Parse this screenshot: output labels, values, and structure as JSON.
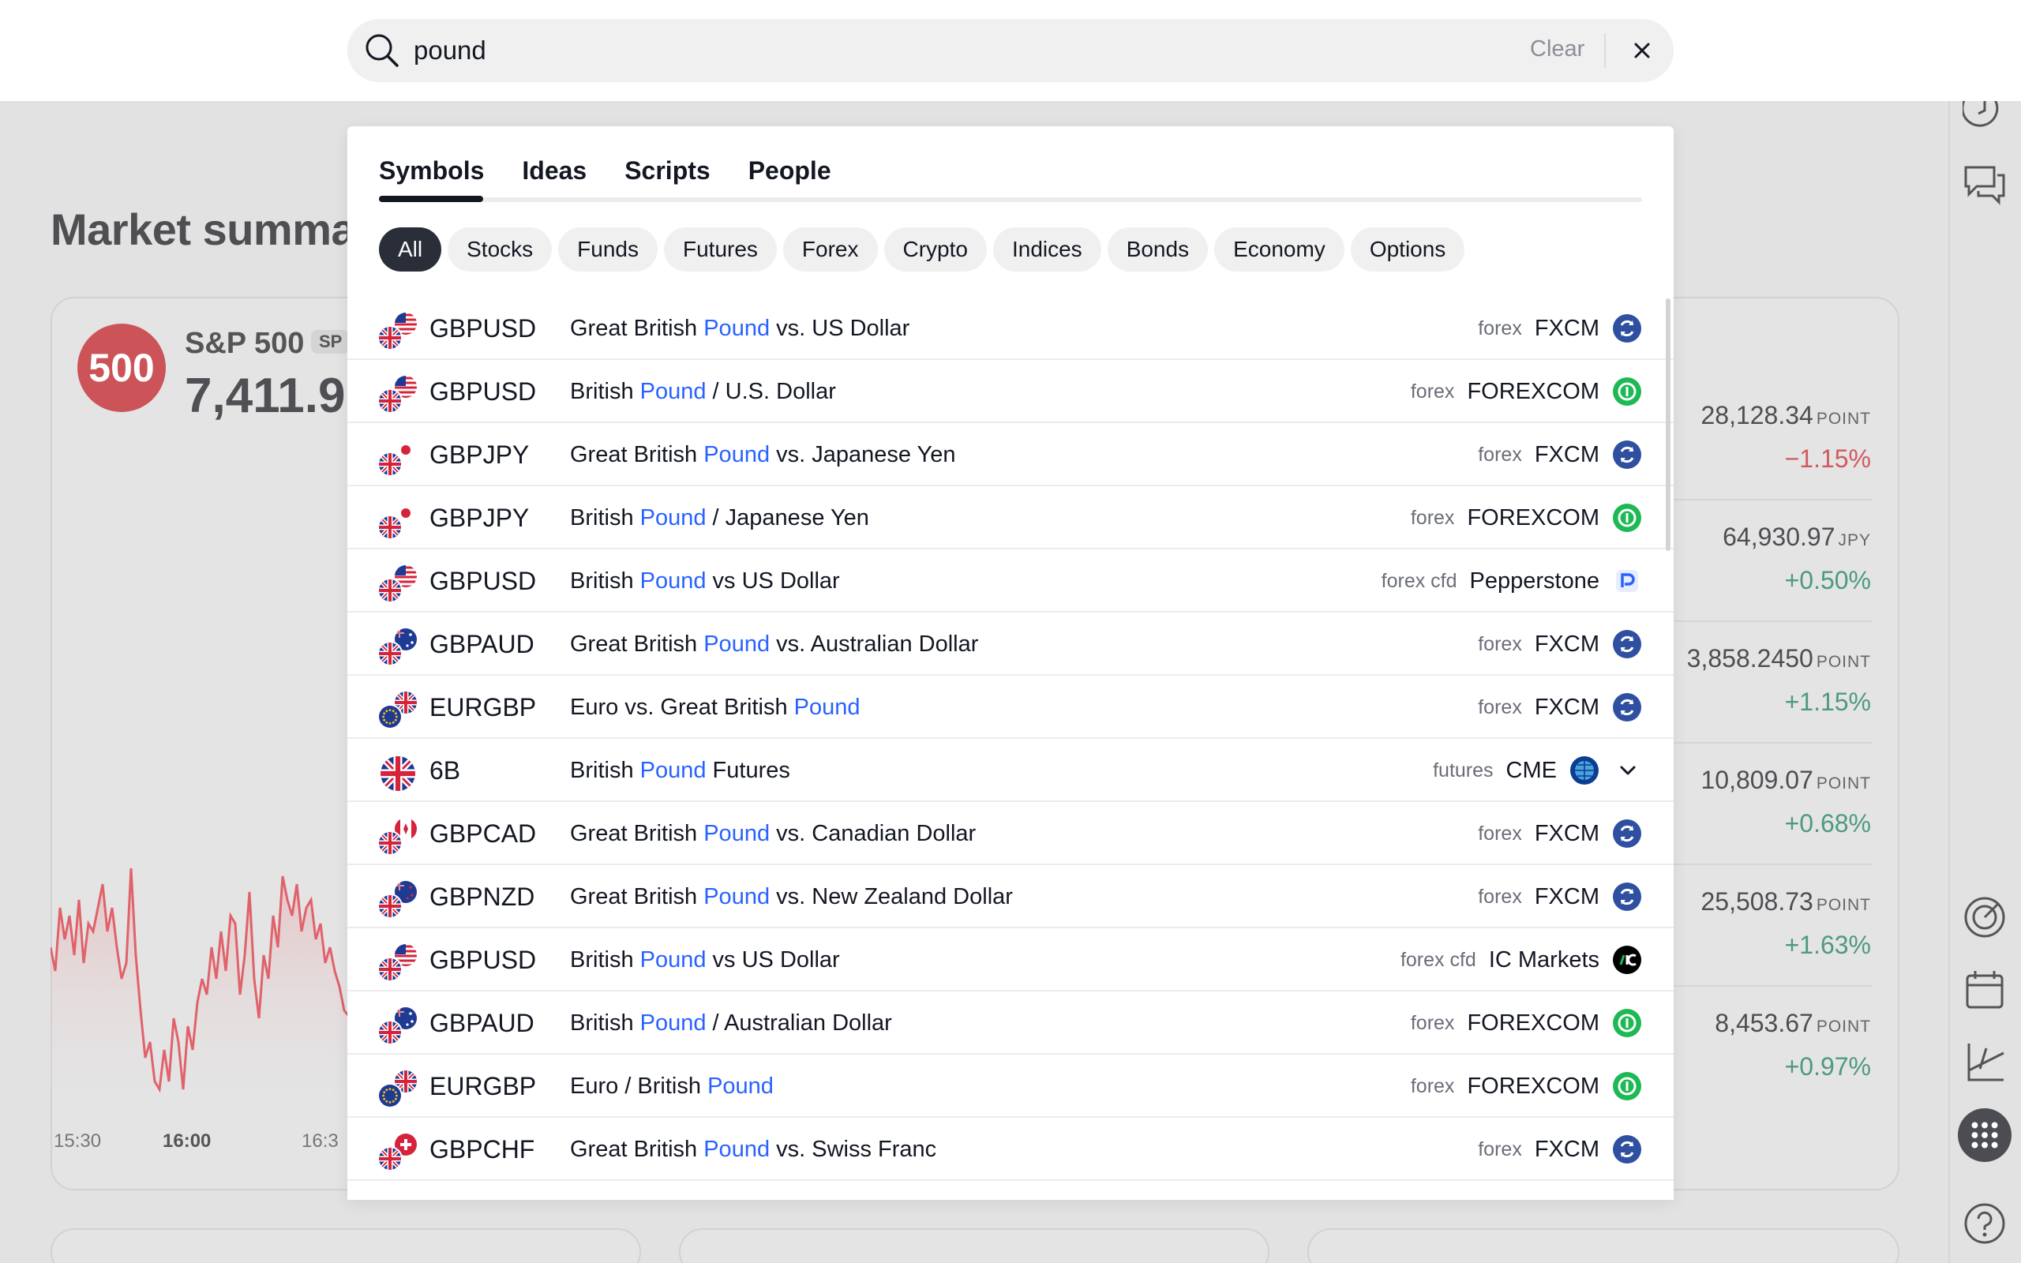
{
  "search": {
    "value": "pound",
    "clear_label": "Clear"
  },
  "tabs": [
    {
      "label": "Symbols",
      "active": true
    },
    {
      "label": "Ideas",
      "active": false
    },
    {
      "label": "Scripts",
      "active": false
    },
    {
      "label": "People",
      "active": false
    }
  ],
  "filters": [
    "All",
    "Stocks",
    "Funds",
    "Futures",
    "Forex",
    "Crypto",
    "Indices",
    "Bonds",
    "Economy",
    "Options"
  ],
  "active_filter": "All",
  "highlight_color": "#2962ff",
  "results": [
    {
      "symbol": "GBPUSD",
      "pre": "Great British ",
      "hl": "Pound",
      "post": " vs. US Dollar",
      "type": "forex",
      "exchange": "FXCM",
      "logo": "fxcm-logo",
      "flag": "gb-us"
    },
    {
      "symbol": "GBPUSD",
      "pre": "British ",
      "hl": "Pound",
      "post": " / U.S. Dollar",
      "type": "forex",
      "exchange": "FOREXCOM",
      "logo": "forexcom-logo",
      "flag": "gb-us"
    },
    {
      "symbol": "GBPJPY",
      "pre": "Great British ",
      "hl": "Pound",
      "post": " vs. Japanese Yen",
      "type": "forex",
      "exchange": "FXCM",
      "logo": "fxcm-logo",
      "flag": "gb-jp"
    },
    {
      "symbol": "GBPJPY",
      "pre": "British ",
      "hl": "Pound",
      "post": " / Japanese Yen",
      "type": "forex",
      "exchange": "FOREXCOM",
      "logo": "forexcom-logo",
      "flag": "gb-jp"
    },
    {
      "symbol": "GBPUSD",
      "pre": "British ",
      "hl": "Pound",
      "post": " vs US Dollar",
      "type": "forex cfd",
      "exchange": "Pepperstone",
      "logo": "pepperstone-logo",
      "flag": "gb-us"
    },
    {
      "symbol": "GBPAUD",
      "pre": "Great British ",
      "hl": "Pound",
      "post": " vs. Australian Dollar",
      "type": "forex",
      "exchange": "FXCM",
      "logo": "fxcm-logo",
      "flag": "gb-au"
    },
    {
      "symbol": "EURGBP",
      "pre": "Euro vs. Great British ",
      "hl": "Pound",
      "post": "",
      "type": "forex",
      "exchange": "FXCM",
      "logo": "fxcm-logo",
      "flag": "eu-gb"
    },
    {
      "symbol": "6B",
      "pre": "British ",
      "hl": "Pound",
      "post": " Futures",
      "type": "futures",
      "exchange": "CME",
      "logo": "cme-logo",
      "flag": "gb",
      "expandable": true
    },
    {
      "symbol": "GBPCAD",
      "pre": "Great British ",
      "hl": "Pound",
      "post": " vs. Canadian Dollar",
      "type": "forex",
      "exchange": "FXCM",
      "logo": "fxcm-logo",
      "flag": "gb-ca"
    },
    {
      "symbol": "GBPNZD",
      "pre": "Great British ",
      "hl": "Pound",
      "post": " vs. New Zealand Dollar",
      "type": "forex",
      "exchange": "FXCM",
      "logo": "fxcm-logo",
      "flag": "gb-nz"
    },
    {
      "symbol": "GBPUSD",
      "pre": "British ",
      "hl": "Pound",
      "post": " vs US Dollar",
      "type": "forex cfd",
      "exchange": "IC Markets",
      "logo": "icmarkets-logo",
      "flag": "gb-us"
    },
    {
      "symbol": "GBPAUD",
      "pre": "British ",
      "hl": "Pound",
      "post": " / Australian Dollar",
      "type": "forex",
      "exchange": "FOREXCOM",
      "logo": "forexcom-logo",
      "flag": "gb-au"
    },
    {
      "symbol": "EURGBP",
      "pre": "Euro / British ",
      "hl": "Pound",
      "post": "",
      "type": "forex",
      "exchange": "FOREXCOM",
      "logo": "forexcom-logo",
      "flag": "eu-gb"
    },
    {
      "symbol": "GBPCHF",
      "pre": "Great British ",
      "hl": "Pound",
      "post": " vs. Swiss Franc",
      "type": "forex",
      "exchange": "FXCM",
      "logo": "fxcm-logo",
      "flag": "gb-ch"
    }
  ],
  "background": {
    "market_title": "Market summa",
    "spx": {
      "badge": "500",
      "name": "S&P 500",
      "ticker": "SP",
      "price": "7,411.9"
    },
    "time_labels": [
      {
        "text": "15:30",
        "bold": false
      },
      {
        "text": "16:00",
        "bold": true
      },
      {
        "text": "16:3",
        "bold": false
      }
    ],
    "list": [
      {
        "price": "28,128.34",
        "unit": "POINT",
        "change": "−1.15%",
        "dir": "neg"
      },
      {
        "price": "64,930.97",
        "unit": "JPY",
        "change": "+0.50%",
        "dir": "pos"
      },
      {
        "price": "3,858.2450",
        "unit": "POINT",
        "change": "+1.15%",
        "dir": "pos"
      },
      {
        "price": "10,809.07",
        "unit": "POINT",
        "change": "+0.68%",
        "dir": "pos"
      },
      {
        "price": "25,508.73",
        "unit": "POINT",
        "change": "+1.63%",
        "dir": "pos"
      },
      {
        "price": "8,453.67",
        "unit": "POINT",
        "change": "+0.97%",
        "dir": "pos"
      }
    ],
    "toolbar_icons": [
      "clock-icon",
      "chat-icon",
      "target-icon",
      "calendar-icon",
      "drawing-icon",
      "apps-grid-icon",
      "help-icon"
    ]
  },
  "colors": {
    "fxcm": "#2f4fa0",
    "forexcom": "#1db954",
    "pepperstone": "#2962ff",
    "cme": "#0b3d91",
    "icmarkets": "#000000",
    "negative": "#d05a60",
    "positive": "#4e9a80"
  }
}
